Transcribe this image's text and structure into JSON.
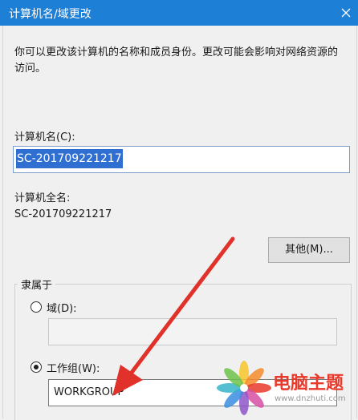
{
  "window": {
    "title": "计算机名/域更改"
  },
  "description": "你可以更改该计算机的名称和成员身份。更改可能会影响对网络资源的访问。",
  "computer_name": {
    "label": "计算机名(C):",
    "value": "SC-201709221217"
  },
  "full_name": {
    "label": "计算机全名:",
    "value": "SC-201709221217"
  },
  "other_button": "其他(M)...",
  "member_of": {
    "title": "隶属于",
    "domain_label": "域(D):",
    "domain_selected": false,
    "workgroup_label": "工作组(W):",
    "workgroup_selected": true,
    "workgroup_value": "WORKGROUP"
  },
  "watermark": {
    "text": "电脑主题",
    "url": "www.dnzhuti.com"
  },
  "colors": {
    "titlebar": "#1e7fd6",
    "selection": "#2f6fd1",
    "arrow": "#e0312a",
    "watermark": "#e8392b"
  }
}
